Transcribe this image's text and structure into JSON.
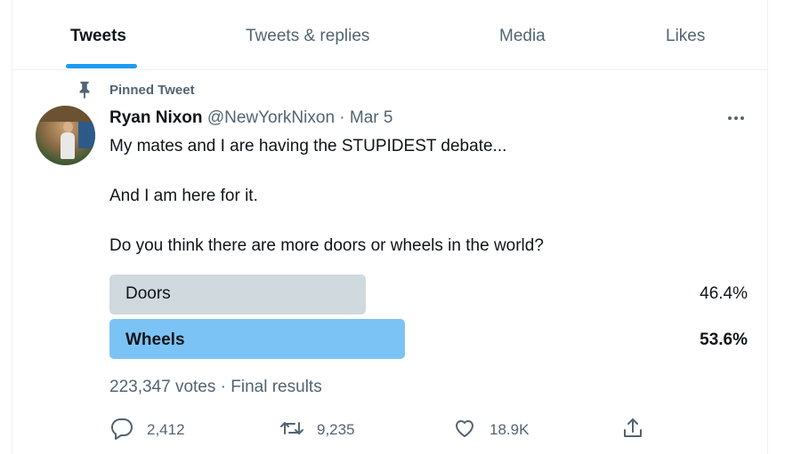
{
  "tabs": [
    {
      "label": "Tweets",
      "active": true
    },
    {
      "label": "Tweets & replies",
      "active": false
    },
    {
      "label": "Media",
      "active": false
    },
    {
      "label": "Likes",
      "active": false
    }
  ],
  "tweet": {
    "pinned_label": "Pinned Tweet",
    "author_name": "Ryan Nixon",
    "handle": "@NewYorkNixon",
    "separator": "·",
    "date": "Mar 5",
    "text_lines": [
      "My mates and I are having the STUPIDEST debate...",
      "And I am here for it.",
      "Do you think there are more doors or wheels in the world?"
    ],
    "poll": {
      "options": [
        {
          "label": "Doors",
          "percent_text": "46.4%",
          "percent": 46.4,
          "winner": false
        },
        {
          "label": "Wheels",
          "percent_text": "53.6%",
          "percent": 53.6,
          "winner": true
        }
      ],
      "votes": "223,347 votes",
      "separator": "·",
      "status": "Final results"
    },
    "actions": {
      "replies": "2,412",
      "retweets": "9,235",
      "likes": "18.9K"
    }
  },
  "icons": {
    "pin": "pin-icon",
    "more": "more-icon",
    "reply": "reply-icon",
    "retweet": "retweet-icon",
    "like": "heart-icon",
    "share": "share-icon"
  },
  "colors": {
    "accent": "#1d9bf0",
    "poll_winner": "#7cc3f5",
    "poll_loser": "#cfd9de",
    "secondary_text": "#536471"
  }
}
